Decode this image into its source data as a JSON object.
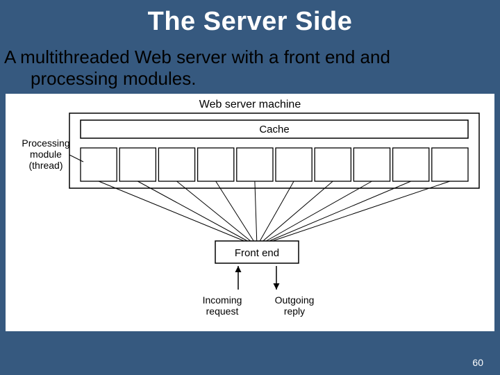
{
  "title": "The Server Side",
  "body_line1": "A multithreaded Web server with a front end and",
  "body_line2": "processing modules.",
  "diagram": {
    "web_server_machine": "Web server machine",
    "cache": "Cache",
    "processing_module_l1": "Processing",
    "processing_module_l2": "module",
    "processing_module_l3": "(thread)",
    "front_end": "Front end",
    "incoming_l1": "Incoming",
    "incoming_l2": "request",
    "outgoing_l1": "Outgoing",
    "outgoing_l2": "reply",
    "module_count": 10
  },
  "page_number": "60"
}
